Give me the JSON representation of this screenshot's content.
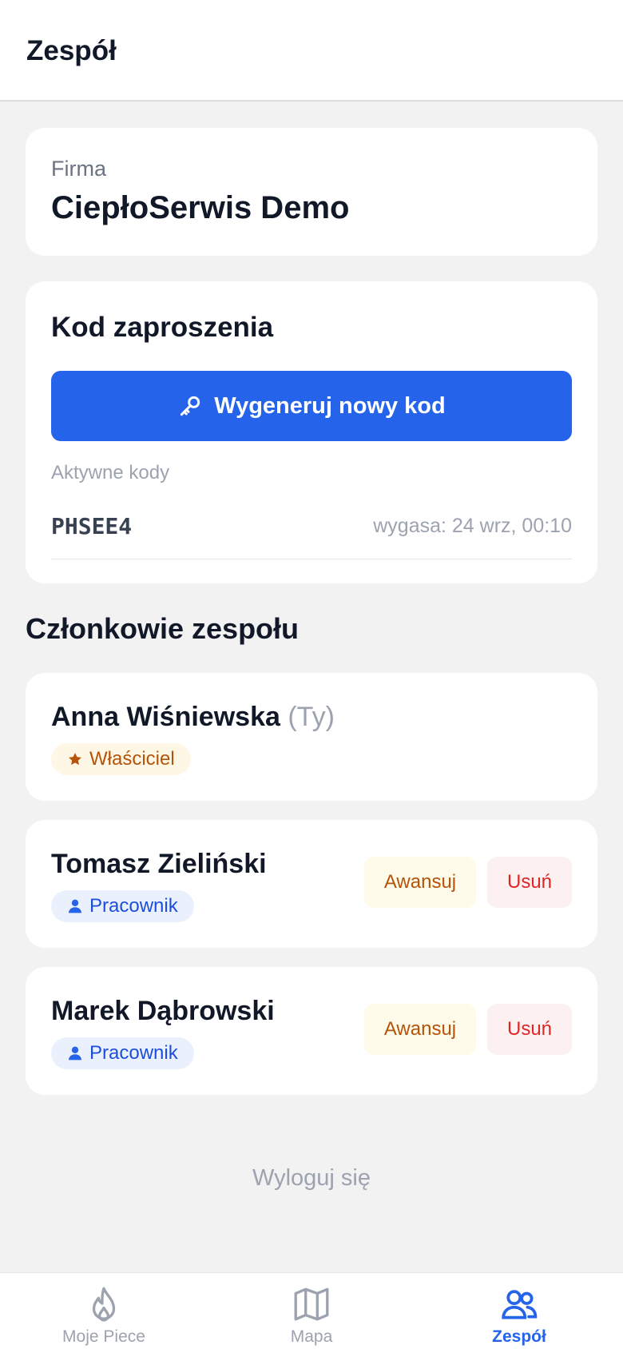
{
  "header": {
    "title": "Zespół"
  },
  "company": {
    "label": "Firma",
    "name": "CiepłoSerwis Demo"
  },
  "invite": {
    "title": "Kod zaproszenia",
    "generate_label": "Wygeneruj nowy kod",
    "active_label": "Aktywne kody",
    "codes": [
      {
        "code": "PHSEE4",
        "expiry": "wygasa: 24 wrz, 00:10"
      }
    ]
  },
  "members": {
    "title": "Członkowie zespołu",
    "items": [
      {
        "name": "Anna Wiśniewska",
        "you_tag": "(Ty)",
        "role": "Właściciel"
      },
      {
        "name": "Tomasz Zieliński",
        "role": "Pracownik",
        "promote_label": "Awansuj",
        "remove_label": "Usuń"
      },
      {
        "name": "Marek Dąbrowski",
        "role": "Pracownik",
        "promote_label": "Awansuj",
        "remove_label": "Usuń"
      }
    ]
  },
  "logout_label": "Wyloguj się",
  "tabs": [
    {
      "label": "Moje Piece",
      "icon": "flame-icon"
    },
    {
      "label": "Mapa",
      "icon": "map-icon"
    },
    {
      "label": "Zespół",
      "icon": "team-icon",
      "active": true
    }
  ],
  "colors": {
    "accent": "#2563eb",
    "owner_badge": "#b45309",
    "danger": "#dc2626"
  }
}
